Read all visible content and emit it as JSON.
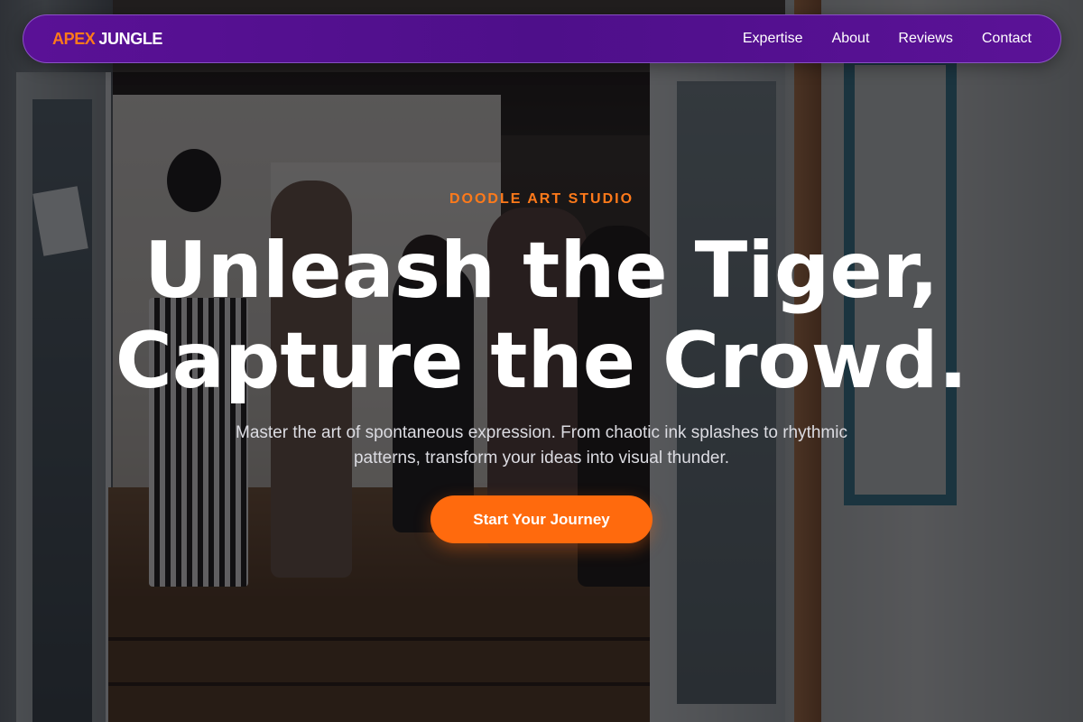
{
  "brand": {
    "name_part1": "APEX",
    "name_part2": "JUNGLE",
    "accent_color": "#ff7a1a",
    "nav_color": "#5a1196"
  },
  "nav": {
    "items": [
      {
        "label": "Expertise"
      },
      {
        "label": "About"
      },
      {
        "label": "Reviews"
      },
      {
        "label": "Contact"
      }
    ]
  },
  "hero": {
    "eyebrow": "DOODLE ART STUDIO",
    "headline_line1": "Unleash the Tiger,",
    "headline_line2": "Capture the Crowd.",
    "subtext": "Master the art of spontaneous expression. From chaotic ink splashes to rhythmic patterns, transform your ideas into visual thunder.",
    "cta_label": "Start Your Journey",
    "cta_color": "#ff6a0d"
  }
}
